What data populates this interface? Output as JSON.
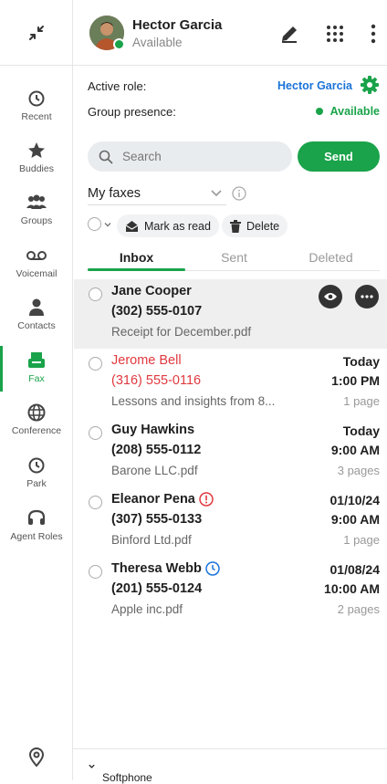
{
  "rail": {
    "items": [
      {
        "label": "Recent",
        "icon": "clock-icon"
      },
      {
        "label": "Buddies",
        "icon": "star-icon"
      },
      {
        "label": "Groups",
        "icon": "people-icon"
      },
      {
        "label": "Voicemail",
        "icon": "voicemail-icon"
      },
      {
        "label": "Contacts",
        "icon": "person-icon"
      },
      {
        "label": "Fax",
        "icon": "fax-icon"
      },
      {
        "label": "Conference",
        "icon": "globe-icon"
      },
      {
        "label": "Park",
        "icon": "clock-icon"
      },
      {
        "label": "Agent Roles",
        "icon": "headset-icon"
      }
    ],
    "active": "Fax"
  },
  "header": {
    "user_name": "Hector Garcia",
    "status": "Available"
  },
  "role": {
    "active_role_label": "Active role:",
    "active_role_value": "Hector Garcia",
    "group_presence_label": "Group presence:",
    "group_presence_value": "Available"
  },
  "search": {
    "placeholder": "Search"
  },
  "send_label": "Send",
  "fax_selector": {
    "value": "My faxes"
  },
  "actions": {
    "mark_read": "Mark as read",
    "delete": "Delete"
  },
  "tabs": [
    {
      "label": "Inbox",
      "active": true
    },
    {
      "label": "Sent",
      "active": false
    },
    {
      "label": "Deleted",
      "active": false
    }
  ],
  "faxes": [
    {
      "name": "Jane Cooper",
      "phone": "(302) 555-0107",
      "file": "Receipt for December.pdf",
      "date": "",
      "time": "",
      "pages": "",
      "highlight": true,
      "unread": false,
      "badge": ""
    },
    {
      "name": "Jerome Bell",
      "phone": "(316) 555-0116",
      "file": "Lessons and insights from 8...",
      "date": "Today",
      "time": "1:00 PM",
      "pages": "1 page",
      "highlight": false,
      "unread": true,
      "badge": ""
    },
    {
      "name": "Guy Hawkins",
      "phone": "(208) 555-0112",
      "file": "Barone LLC.pdf",
      "date": "Today",
      "time": "9:00 AM",
      "pages": "3 pages",
      "highlight": false,
      "unread": false,
      "badge": ""
    },
    {
      "name": "Eleanor Pena",
      "phone": "(307) 555-0133",
      "file": "Binford Ltd.pdf",
      "date": "01/10/24",
      "time": "9:00 AM",
      "pages": "1 page",
      "highlight": false,
      "unread": false,
      "badge": "error"
    },
    {
      "name": "Theresa Webb",
      "phone": "(201) 555-0124",
      "file": "Apple inc.pdf",
      "date": "01/08/24",
      "time": "10:00 AM",
      "pages": "2 pages",
      "highlight": false,
      "unread": false,
      "badge": "pending"
    }
  ],
  "footer": {
    "softphone_label": "Softphone"
  },
  "colors": {
    "accent": "#1aa34a",
    "link": "#1a73d9",
    "unread": "#e0393e",
    "error": "#e0393e",
    "pending": "#1a73d9"
  }
}
